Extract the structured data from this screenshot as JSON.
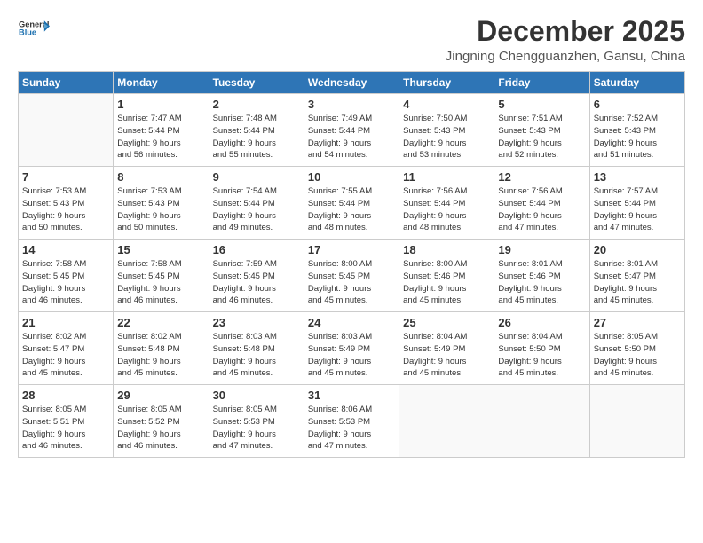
{
  "header": {
    "logo_general": "General",
    "logo_blue": "Blue",
    "month": "December 2025",
    "location": "Jingning Chengguanzhen, Gansu, China"
  },
  "days_of_week": [
    "Sunday",
    "Monday",
    "Tuesday",
    "Wednesday",
    "Thursday",
    "Friday",
    "Saturday"
  ],
  "weeks": [
    [
      {
        "day": "",
        "sunrise": "",
        "sunset": "",
        "daylight": ""
      },
      {
        "day": "1",
        "sunrise": "Sunrise: 7:47 AM",
        "sunset": "Sunset: 5:44 PM",
        "daylight": "Daylight: 9 hours and 56 minutes."
      },
      {
        "day": "2",
        "sunrise": "Sunrise: 7:48 AM",
        "sunset": "Sunset: 5:44 PM",
        "daylight": "Daylight: 9 hours and 55 minutes."
      },
      {
        "day": "3",
        "sunrise": "Sunrise: 7:49 AM",
        "sunset": "Sunset: 5:44 PM",
        "daylight": "Daylight: 9 hours and 54 minutes."
      },
      {
        "day": "4",
        "sunrise": "Sunrise: 7:50 AM",
        "sunset": "Sunset: 5:43 PM",
        "daylight": "Daylight: 9 hours and 53 minutes."
      },
      {
        "day": "5",
        "sunrise": "Sunrise: 7:51 AM",
        "sunset": "Sunset: 5:43 PM",
        "daylight": "Daylight: 9 hours and 52 minutes."
      },
      {
        "day": "6",
        "sunrise": "Sunrise: 7:52 AM",
        "sunset": "Sunset: 5:43 PM",
        "daylight": "Daylight: 9 hours and 51 minutes."
      }
    ],
    [
      {
        "day": "7",
        "sunrise": "Sunrise: 7:53 AM",
        "sunset": "Sunset: 5:43 PM",
        "daylight": "Daylight: 9 hours and 50 minutes."
      },
      {
        "day": "8",
        "sunrise": "Sunrise: 7:53 AM",
        "sunset": "Sunset: 5:43 PM",
        "daylight": "Daylight: 9 hours and 50 minutes."
      },
      {
        "day": "9",
        "sunrise": "Sunrise: 7:54 AM",
        "sunset": "Sunset: 5:44 PM",
        "daylight": "Daylight: 9 hours and 49 minutes."
      },
      {
        "day": "10",
        "sunrise": "Sunrise: 7:55 AM",
        "sunset": "Sunset: 5:44 PM",
        "daylight": "Daylight: 9 hours and 48 minutes."
      },
      {
        "day": "11",
        "sunrise": "Sunrise: 7:56 AM",
        "sunset": "Sunset: 5:44 PM",
        "daylight": "Daylight: 9 hours and 48 minutes."
      },
      {
        "day": "12",
        "sunrise": "Sunrise: 7:56 AM",
        "sunset": "Sunset: 5:44 PM",
        "daylight": "Daylight: 9 hours and 47 minutes."
      },
      {
        "day": "13",
        "sunrise": "Sunrise: 7:57 AM",
        "sunset": "Sunset: 5:44 PM",
        "daylight": "Daylight: 9 hours and 47 minutes."
      }
    ],
    [
      {
        "day": "14",
        "sunrise": "Sunrise: 7:58 AM",
        "sunset": "Sunset: 5:45 PM",
        "daylight": "Daylight: 9 hours and 46 minutes."
      },
      {
        "day": "15",
        "sunrise": "Sunrise: 7:58 AM",
        "sunset": "Sunset: 5:45 PM",
        "daylight": "Daylight: 9 hours and 46 minutes."
      },
      {
        "day": "16",
        "sunrise": "Sunrise: 7:59 AM",
        "sunset": "Sunset: 5:45 PM",
        "daylight": "Daylight: 9 hours and 46 minutes."
      },
      {
        "day": "17",
        "sunrise": "Sunrise: 8:00 AM",
        "sunset": "Sunset: 5:45 PM",
        "daylight": "Daylight: 9 hours and 45 minutes."
      },
      {
        "day": "18",
        "sunrise": "Sunrise: 8:00 AM",
        "sunset": "Sunset: 5:46 PM",
        "daylight": "Daylight: 9 hours and 45 minutes."
      },
      {
        "day": "19",
        "sunrise": "Sunrise: 8:01 AM",
        "sunset": "Sunset: 5:46 PM",
        "daylight": "Daylight: 9 hours and 45 minutes."
      },
      {
        "day": "20",
        "sunrise": "Sunrise: 8:01 AM",
        "sunset": "Sunset: 5:47 PM",
        "daylight": "Daylight: 9 hours and 45 minutes."
      }
    ],
    [
      {
        "day": "21",
        "sunrise": "Sunrise: 8:02 AM",
        "sunset": "Sunset: 5:47 PM",
        "daylight": "Daylight: 9 hours and 45 minutes."
      },
      {
        "day": "22",
        "sunrise": "Sunrise: 8:02 AM",
        "sunset": "Sunset: 5:48 PM",
        "daylight": "Daylight: 9 hours and 45 minutes."
      },
      {
        "day": "23",
        "sunrise": "Sunrise: 8:03 AM",
        "sunset": "Sunset: 5:48 PM",
        "daylight": "Daylight: 9 hours and 45 minutes."
      },
      {
        "day": "24",
        "sunrise": "Sunrise: 8:03 AM",
        "sunset": "Sunset: 5:49 PM",
        "daylight": "Daylight: 9 hours and 45 minutes."
      },
      {
        "day": "25",
        "sunrise": "Sunrise: 8:04 AM",
        "sunset": "Sunset: 5:49 PM",
        "daylight": "Daylight: 9 hours and 45 minutes."
      },
      {
        "day": "26",
        "sunrise": "Sunrise: 8:04 AM",
        "sunset": "Sunset: 5:50 PM",
        "daylight": "Daylight: 9 hours and 45 minutes."
      },
      {
        "day": "27",
        "sunrise": "Sunrise: 8:05 AM",
        "sunset": "Sunset: 5:50 PM",
        "daylight": "Daylight: 9 hours and 45 minutes."
      }
    ],
    [
      {
        "day": "28",
        "sunrise": "Sunrise: 8:05 AM",
        "sunset": "Sunset: 5:51 PM",
        "daylight": "Daylight: 9 hours and 46 minutes."
      },
      {
        "day": "29",
        "sunrise": "Sunrise: 8:05 AM",
        "sunset": "Sunset: 5:52 PM",
        "daylight": "Daylight: 9 hours and 46 minutes."
      },
      {
        "day": "30",
        "sunrise": "Sunrise: 8:05 AM",
        "sunset": "Sunset: 5:53 PM",
        "daylight": "Daylight: 9 hours and 47 minutes."
      },
      {
        "day": "31",
        "sunrise": "Sunrise: 8:06 AM",
        "sunset": "Sunset: 5:53 PM",
        "daylight": "Daylight: 9 hours and 47 minutes."
      },
      {
        "day": "",
        "sunrise": "",
        "sunset": "",
        "daylight": ""
      },
      {
        "day": "",
        "sunrise": "",
        "sunset": "",
        "daylight": ""
      },
      {
        "day": "",
        "sunrise": "",
        "sunset": "",
        "daylight": ""
      }
    ]
  ]
}
